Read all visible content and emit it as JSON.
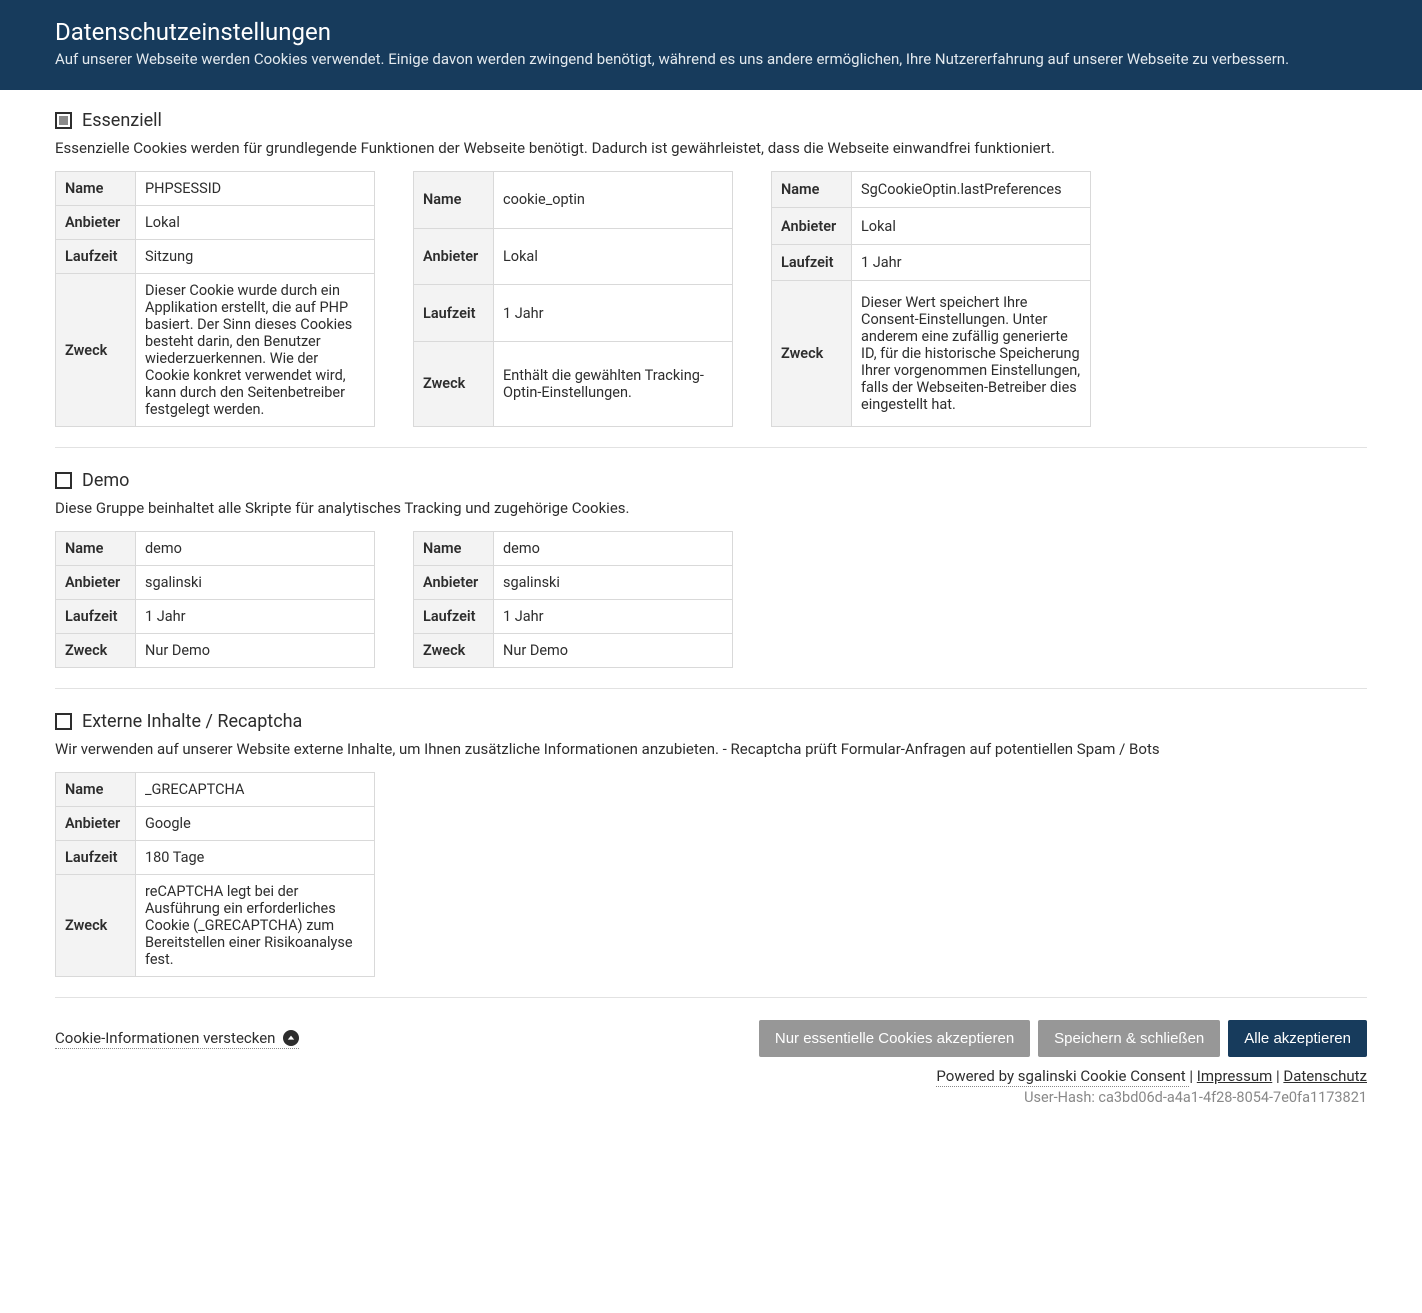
{
  "header": {
    "title": "Datenschutzeinstellungen",
    "subtitle": "Auf unserer Webseite werden Cookies verwendet. Einige davon werden zwingend benötigt, während es uns andere ermöglichen, Ihre Nutzererfahrung auf unserer Webseite zu verbessern."
  },
  "labels": {
    "name": "Name",
    "provider": "Anbieter",
    "lifetime": "Laufzeit",
    "purpose": "Zweck"
  },
  "groups": [
    {
      "id": "essential",
      "title": "Essenziell",
      "checked": "indeterminate",
      "desc": "Essenzielle Cookies werden für grundlegende Funktionen der Webseite benötigt. Dadurch ist gewährleistet, dass die Webseite einwandfrei funktioniert.",
      "cookies": [
        {
          "name": "PHPSESSID",
          "provider": "Lokal",
          "lifetime": "Sitzung",
          "purpose": "Dieser Cookie wurde durch ein Applikation erstellt, die auf PHP basiert. Der Sinn dieses Cookies besteht darin, den Benutzer wiederzuerkennen. Wie der Cookie konkret verwendet wird, kann durch den Seitenbetreiber festgelegt werden."
        },
        {
          "name": "cookie_optin",
          "provider": "Lokal",
          "lifetime": "1 Jahr",
          "purpose": "Enthält die gewählten Tracking-Optin-Einstellungen."
        },
        {
          "name": "SgCookieOptin.lastPreferences",
          "provider": "Lokal",
          "lifetime": "1 Jahr",
          "purpose": "Dieser Wert speichert Ihre Consent-Einstellungen. Unter anderem eine zufällig generierte ID, für die historische Speicherung Ihrer vorgenommen Einstellungen, falls der Webseiten-Betreiber dies eingestellt hat."
        }
      ]
    },
    {
      "id": "demo",
      "title": "Demo",
      "checked": "false",
      "desc": "Diese Gruppe beinhaltet alle Skripte für analytisches Tracking und zugehörige Cookies.",
      "cookies": [
        {
          "name": "demo",
          "provider": "sgalinski",
          "lifetime": "1 Jahr",
          "purpose": "Nur Demo"
        },
        {
          "name": "demo",
          "provider": "sgalinski",
          "lifetime": "1 Jahr",
          "purpose": "Nur Demo"
        }
      ]
    },
    {
      "id": "external",
      "title": "Externe Inhalte / Recaptcha",
      "checked": "false",
      "desc": "Wir verwenden auf unserer Website externe Inhalte, um Ihnen zusätzliche Informationen anzubieten. - Recaptcha prüft Formular-Anfragen auf potentiellen Spam / Bots",
      "cookies": [
        {
          "name": "_GRECAPTCHA",
          "provider": "Google",
          "lifetime": "180 Tage",
          "purpose": "reCAPTCHA legt bei der Ausführung ein erforderliches Cookie (_GRECAPTCHA) zum Bereitstellen einer Risikoanalyse fest."
        }
      ]
    }
  ],
  "footer": {
    "hide_info": "Cookie-Informationen verstecken",
    "btn_essential": "Nur essentielle Cookies akzeptieren",
    "btn_save": "Speichern & schließen",
    "btn_all": "Alle akzeptieren",
    "powered": "Powered by sgalinski Cookie Consent ",
    "imprint": "Impressum",
    "privacy": "Datenschutz",
    "sep": " | ",
    "userhash_label": "User-Hash: ",
    "userhash": "ca3bd06d-a4a1-4f28-8054-7e0fa1173821"
  }
}
